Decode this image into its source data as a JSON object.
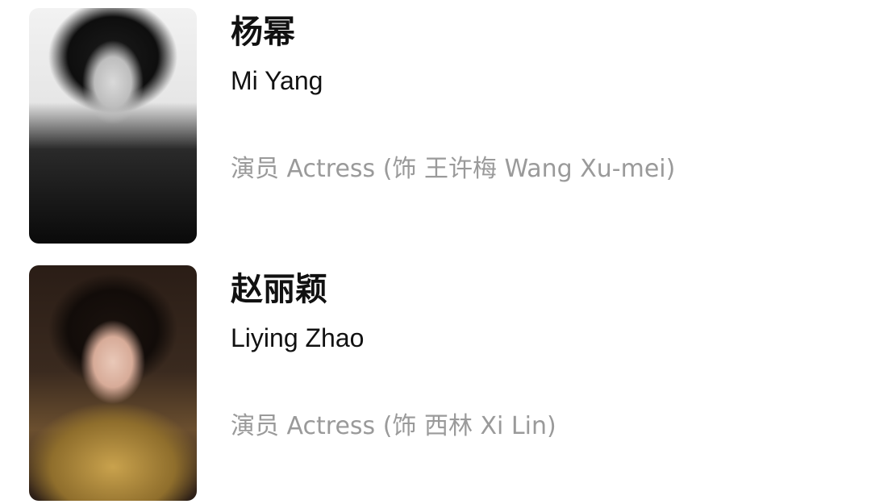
{
  "cast": [
    {
      "name_zh": "杨幂",
      "name_en": "Mi Yang",
      "role": "演员 Actress (饰 王许梅 Wang Xu-mei)",
      "photo_style": "black-and-white portrait"
    },
    {
      "name_zh": "赵丽颖",
      "name_en": "Liying Zhao",
      "role": "演员 Actress (饰 西林 Xi Lin)",
      "photo_style": "color portrait, gold dress"
    }
  ],
  "colors": {
    "background": "#ffffff",
    "primary_text": "#111111",
    "secondary_text": "#9a9a9a"
  }
}
